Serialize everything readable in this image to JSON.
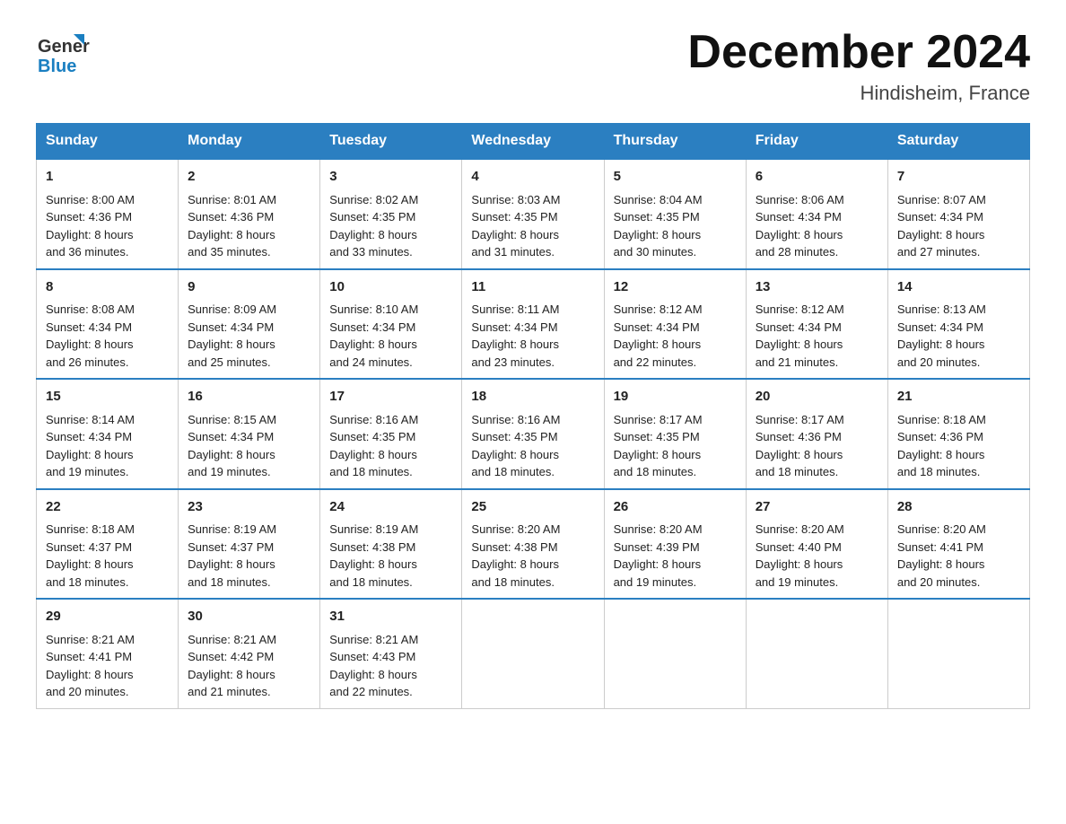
{
  "header": {
    "logo_line1": "General",
    "logo_line2": "Blue",
    "month_title": "December 2024",
    "location": "Hindisheim, France"
  },
  "days_of_week": [
    "Sunday",
    "Monday",
    "Tuesday",
    "Wednesday",
    "Thursday",
    "Friday",
    "Saturday"
  ],
  "weeks": [
    [
      {
        "day": "1",
        "sunrise": "8:00 AM",
        "sunset": "4:36 PM",
        "daylight": "8 hours and 36 minutes."
      },
      {
        "day": "2",
        "sunrise": "8:01 AM",
        "sunset": "4:36 PM",
        "daylight": "8 hours and 35 minutes."
      },
      {
        "day": "3",
        "sunrise": "8:02 AM",
        "sunset": "4:35 PM",
        "daylight": "8 hours and 33 minutes."
      },
      {
        "day": "4",
        "sunrise": "8:03 AM",
        "sunset": "4:35 PM",
        "daylight": "8 hours and 31 minutes."
      },
      {
        "day": "5",
        "sunrise": "8:04 AM",
        "sunset": "4:35 PM",
        "daylight": "8 hours and 30 minutes."
      },
      {
        "day": "6",
        "sunrise": "8:06 AM",
        "sunset": "4:34 PM",
        "daylight": "8 hours and 28 minutes."
      },
      {
        "day": "7",
        "sunrise": "8:07 AM",
        "sunset": "4:34 PM",
        "daylight": "8 hours and 27 minutes."
      }
    ],
    [
      {
        "day": "8",
        "sunrise": "8:08 AM",
        "sunset": "4:34 PM",
        "daylight": "8 hours and 26 minutes."
      },
      {
        "day": "9",
        "sunrise": "8:09 AM",
        "sunset": "4:34 PM",
        "daylight": "8 hours and 25 minutes."
      },
      {
        "day": "10",
        "sunrise": "8:10 AM",
        "sunset": "4:34 PM",
        "daylight": "8 hours and 24 minutes."
      },
      {
        "day": "11",
        "sunrise": "8:11 AM",
        "sunset": "4:34 PM",
        "daylight": "8 hours and 23 minutes."
      },
      {
        "day": "12",
        "sunrise": "8:12 AM",
        "sunset": "4:34 PM",
        "daylight": "8 hours and 22 minutes."
      },
      {
        "day": "13",
        "sunrise": "8:12 AM",
        "sunset": "4:34 PM",
        "daylight": "8 hours and 21 minutes."
      },
      {
        "day": "14",
        "sunrise": "8:13 AM",
        "sunset": "4:34 PM",
        "daylight": "8 hours and 20 minutes."
      }
    ],
    [
      {
        "day": "15",
        "sunrise": "8:14 AM",
        "sunset": "4:34 PM",
        "daylight": "8 hours and 19 minutes."
      },
      {
        "day": "16",
        "sunrise": "8:15 AM",
        "sunset": "4:34 PM",
        "daylight": "8 hours and 19 minutes."
      },
      {
        "day": "17",
        "sunrise": "8:16 AM",
        "sunset": "4:35 PM",
        "daylight": "8 hours and 18 minutes."
      },
      {
        "day": "18",
        "sunrise": "8:16 AM",
        "sunset": "4:35 PM",
        "daylight": "8 hours and 18 minutes."
      },
      {
        "day": "19",
        "sunrise": "8:17 AM",
        "sunset": "4:35 PM",
        "daylight": "8 hours and 18 minutes."
      },
      {
        "day": "20",
        "sunrise": "8:17 AM",
        "sunset": "4:36 PM",
        "daylight": "8 hours and 18 minutes."
      },
      {
        "day": "21",
        "sunrise": "8:18 AM",
        "sunset": "4:36 PM",
        "daylight": "8 hours and 18 minutes."
      }
    ],
    [
      {
        "day": "22",
        "sunrise": "8:18 AM",
        "sunset": "4:37 PM",
        "daylight": "8 hours and 18 minutes."
      },
      {
        "day": "23",
        "sunrise": "8:19 AM",
        "sunset": "4:37 PM",
        "daylight": "8 hours and 18 minutes."
      },
      {
        "day": "24",
        "sunrise": "8:19 AM",
        "sunset": "4:38 PM",
        "daylight": "8 hours and 18 minutes."
      },
      {
        "day": "25",
        "sunrise": "8:20 AM",
        "sunset": "4:38 PM",
        "daylight": "8 hours and 18 minutes."
      },
      {
        "day": "26",
        "sunrise": "8:20 AM",
        "sunset": "4:39 PM",
        "daylight": "8 hours and 19 minutes."
      },
      {
        "day": "27",
        "sunrise": "8:20 AM",
        "sunset": "4:40 PM",
        "daylight": "8 hours and 19 minutes."
      },
      {
        "day": "28",
        "sunrise": "8:20 AM",
        "sunset": "4:41 PM",
        "daylight": "8 hours and 20 minutes."
      }
    ],
    [
      {
        "day": "29",
        "sunrise": "8:21 AM",
        "sunset": "4:41 PM",
        "daylight": "8 hours and 20 minutes."
      },
      {
        "day": "30",
        "sunrise": "8:21 AM",
        "sunset": "4:42 PM",
        "daylight": "8 hours and 21 minutes."
      },
      {
        "day": "31",
        "sunrise": "8:21 AM",
        "sunset": "4:43 PM",
        "daylight": "8 hours and 22 minutes."
      },
      null,
      null,
      null,
      null
    ]
  ],
  "labels": {
    "sunrise": "Sunrise:",
    "sunset": "Sunset:",
    "daylight": "Daylight:"
  }
}
